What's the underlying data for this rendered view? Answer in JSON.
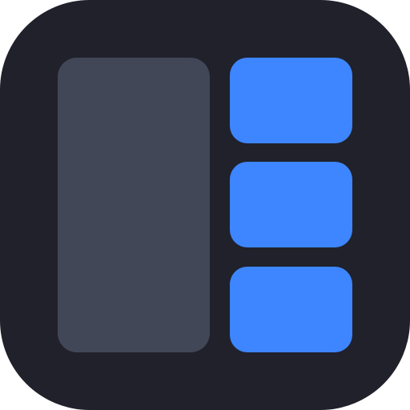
{
  "icon": {
    "name": "layout-panels-app-icon",
    "colors": {
      "background": "#20212b",
      "sidebar_panel": "#424758",
      "tile": "#3d86ff"
    },
    "tiles": [
      {
        "name": "tile-top"
      },
      {
        "name": "tile-middle"
      },
      {
        "name": "tile-bottom"
      }
    ]
  }
}
